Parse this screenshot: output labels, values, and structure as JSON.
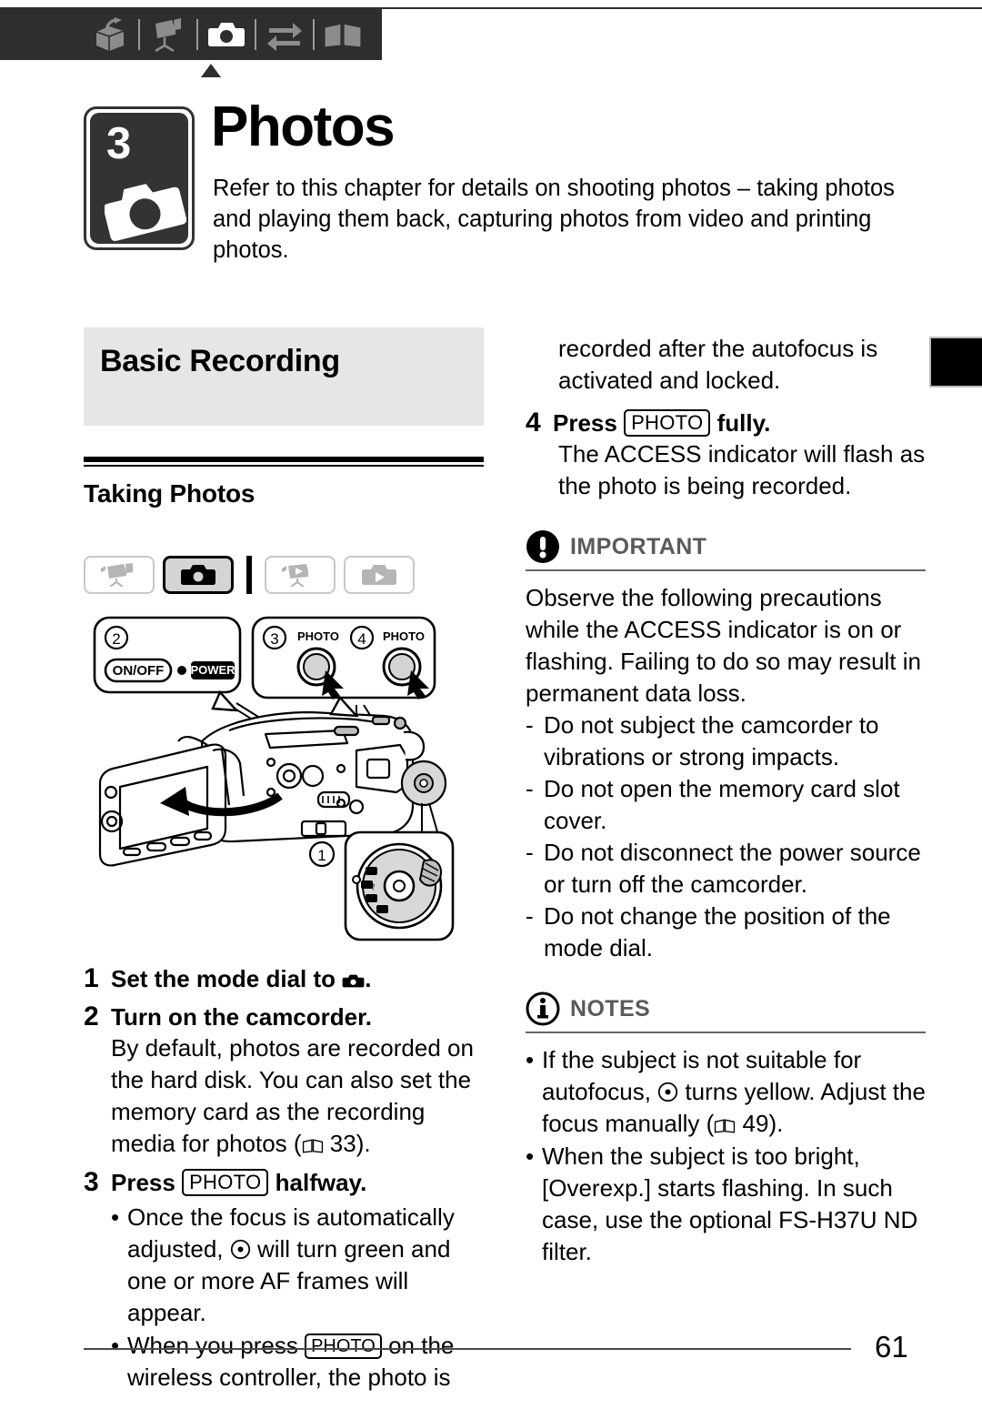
{
  "topbar": {
    "icons": [
      {
        "name": "intro-box-icon",
        "label": "Introduction"
      },
      {
        "name": "video-camcorder-icon",
        "label": "Video"
      },
      {
        "name": "photo-camera-icon",
        "label": "Photos"
      },
      {
        "name": "transfer-arrows-icon",
        "label": "External Connections"
      },
      {
        "name": "book-icon",
        "label": "Additional Information"
      }
    ],
    "active_index": 2,
    "bar_color": "#2e2e2e",
    "icon_color": "#8c8c8c",
    "active_icon_color": "#ffffff"
  },
  "chapter": {
    "number": "3",
    "title": "Photos",
    "badge_icon": "photo-camera-icon",
    "intro": "Refer to this chapter for details on shooting photos – taking photos and playing them back, capturing photos from video and printing photos."
  },
  "section": {
    "heading": "Basic Recording",
    "subheading": "Taking Photos",
    "heading_bg": "#e6e6e6"
  },
  "mode_buttons": [
    {
      "name": "mode-video-record-icon",
      "active": false
    },
    {
      "name": "mode-photo-record-icon",
      "active": true
    },
    {
      "name": "mode-video-play-icon",
      "active": false
    },
    {
      "name": "mode-photo-play-icon",
      "active": false
    }
  ],
  "illustration": {
    "name": "camcorder-diagram",
    "callouts": {
      "power": {
        "marker": "2",
        "button_label": "ON/OFF",
        "indicator_label": "POWER"
      },
      "photo_halfway": {
        "marker": "3",
        "button_label": "PHOTO"
      },
      "photo_full": {
        "marker": "4",
        "button_label": "PHOTO"
      },
      "mode_dial": {
        "marker": "1"
      }
    }
  },
  "steps": [
    {
      "num": "1",
      "title_before": "Set the mode dial to ",
      "title_icon": "photo-camera-icon",
      "title_after": "."
    },
    {
      "num": "2",
      "title_before": "Turn on the camcorder.",
      "body_part1": "By default, photos are recorded on the hard disk. You can also set the memory card as the recording media for photos (",
      "body_icon": "book-page-icon",
      "body_page": "33",
      "body_part2": ")."
    },
    {
      "num": "3",
      "title_before": "Press ",
      "keycap": "PHOTO",
      "title_after": " halfway.",
      "bullets": [
        {
          "part1": "Once the focus is automatically adjusted, ",
          "icon": "focus-dot-icon",
          "part2": " will turn green and one or more AF frames will appear."
        },
        {
          "part1": "When you press ",
          "keycap": "PHOTO",
          "part2": " on the wireless controller, the photo is recorded after the autofocus is activated and locked."
        }
      ]
    },
    {
      "num": "4",
      "title_before": "Press ",
      "keycap": "PHOTO",
      "title_after": " fully.",
      "body_part1": "The ACCESS indicator will flash as the photo is being recorded."
    }
  ],
  "right_column": {
    "continuation": "recorded after the autofocus is activated and locked.",
    "step4": {
      "num": "4",
      "title_before": "Press ",
      "keycap": "PHOTO",
      "title_after": " fully.",
      "body": "The ACCESS indicator will flash as the photo is being recorded."
    },
    "important": {
      "label": "IMPORTANT",
      "icon": "exclamation-circle-icon",
      "intro": "Observe the following precautions while the ACCESS indicator is on or flashing. Failing to do so may result in permanent data loss.",
      "items": [
        "Do not subject the camcorder to vibrations or strong impacts.",
        "Do not open the memory card slot cover.",
        "Do not disconnect the power source or turn off the camcorder.",
        "Do not change the position of the mode dial."
      ],
      "dash": "-"
    },
    "notes": {
      "label": "NOTES",
      "icon": "info-circle-icon",
      "bullet": "•",
      "items": [
        {
          "part1": "If the subject is not suitable for autofocus, ",
          "icon": "focus-dot-icon",
          "part2": " turns yellow. Adjust the focus manually (",
          "page_icon": "book-page-icon",
          "page": "49",
          "part3": ")."
        },
        {
          "part1": "When the subject is too bright, [Overexp.] starts flashing. In such case, use the optional FS-H37U ND filter."
        }
      ]
    }
  },
  "footer": {
    "page_number": "61"
  }
}
